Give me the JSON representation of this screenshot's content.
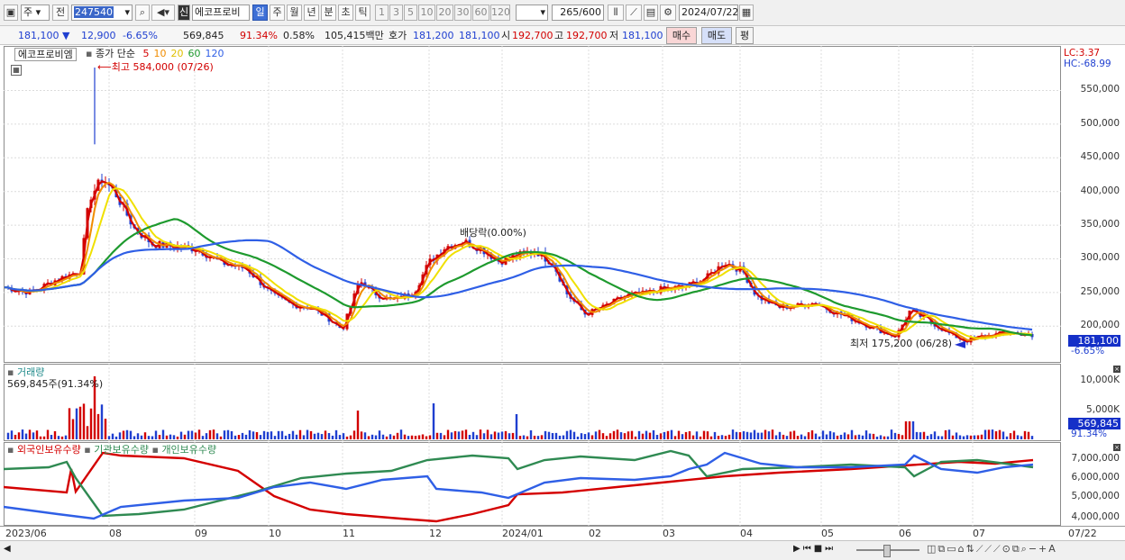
{
  "toolbar": {
    "type_select": "주",
    "prev_label": "전",
    "code": "247540",
    "stock_name_badge": "신",
    "stock_name": "에코프로비",
    "periods": [
      "일",
      "주",
      "월",
      "년",
      "분",
      "초",
      "틱"
    ],
    "intervals": [
      "1",
      "3",
      "5",
      "10",
      "20",
      "30",
      "60",
      "120"
    ],
    "count": "265",
    "count_total": "/600",
    "date": "2024/07/22"
  },
  "quote": {
    "price": "181,100 ▼",
    "change": "12,900",
    "change_pct": "-6.65%",
    "volume": "569,845",
    "volume_ratio": "91.34%",
    "turnover_pct": "0.58%",
    "amount": "105,415백만",
    "hoga_label": "호가",
    "ask": "181,200",
    "bid": "181,100",
    "open_label": "시",
    "open": "192,700",
    "high_label": "고",
    "high": "192,700",
    "low_label": "저",
    "low": "181,100",
    "buy_label": "매수",
    "sell_label": "매도",
    "extra_label": "평"
  },
  "price_panel": {
    "name": "에코프로비엠",
    "legend_title": "종가 단순",
    "ma_labels": [
      "5",
      "10",
      "20",
      "60",
      "120"
    ],
    "max_note": "최고 584,000 (07/26)",
    "min_note": "최저 175,200 (06/28)",
    "dividend_note": "배당락(0.00%)",
    "lc_label": "LC:3.37",
    "hc_label": "HC:-68.99",
    "y_ticks": [
      "550,000",
      "500,000",
      "450,000",
      "400,000",
      "350,000",
      "300,000",
      "250,000",
      "200,000"
    ],
    "current_tag": "181,100",
    "current_pct": "-6.65%"
  },
  "volume_panel": {
    "title": "거래량",
    "value_note": "569,845주(91.34%)",
    "y_ticks": [
      "10,000K",
      "5,000K"
    ],
    "current_tag": "569,845",
    "current_pct": "91.34%"
  },
  "holding_panel": {
    "legend": [
      "외국인보유수량",
      "기관보유수량",
      "개인보유수량"
    ],
    "y_ticks": [
      "7,000,000",
      "6,000,000",
      "5,000,000",
      "4,000,000"
    ]
  },
  "x_axis": [
    "2023/06",
    "08",
    "09",
    "10",
    "11",
    "12",
    "2024/01",
    "02",
    "03",
    "04",
    "05",
    "06",
    "07",
    "07/22"
  ],
  "colors": {
    "up": "#d20000",
    "down": "#1f3fd0",
    "ma5": "#d40000",
    "ma10": "#f08c00",
    "ma20": "#f0e000",
    "ma60": "#1e9a2e",
    "ma120": "#2f5fe6",
    "foreign": "#d40000",
    "institution": "#2f8a52",
    "individual": "#2f5fe6"
  }
}
